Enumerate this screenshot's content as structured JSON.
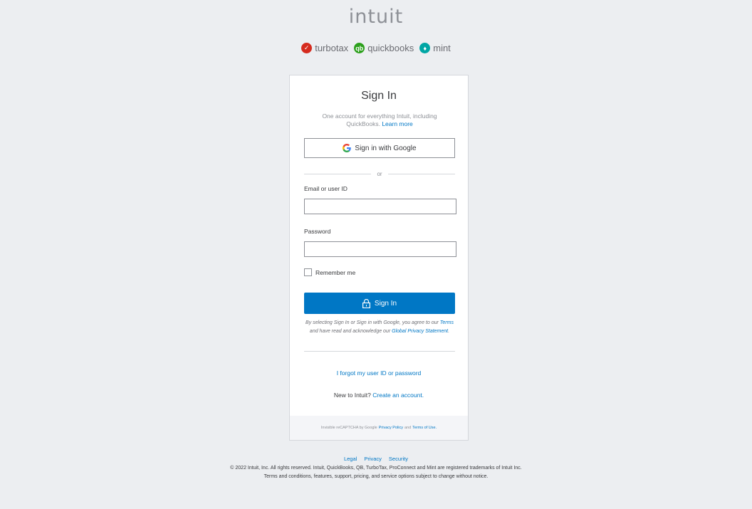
{
  "brand": {
    "logo_text": "INTUIT",
    "accent_color": "#0077c5"
  },
  "products": [
    {
      "name": "turbotax",
      "icon": "turbotax-check-icon",
      "color": "#d52b1e"
    },
    {
      "name": "quickbooks",
      "icon": "quickbooks-qb-icon",
      "color": "#2ca01c"
    },
    {
      "name": "mint",
      "icon": "mint-leaf-icon",
      "color": "#00a6a4"
    }
  ],
  "card": {
    "title": "Sign In",
    "subtitle": "One account for everything Intuit, including QuickBooks.",
    "learn_more": "Learn more",
    "google_button": "Sign in with Google",
    "divider_text": "or",
    "email_label": "Email or user ID",
    "email_value": "",
    "password_label": "Password",
    "password_value": "",
    "remember_label": "Remember me",
    "signin_button": "Sign In",
    "legal_prefix": "By selecting Sign In or Sign in with Google, you agree to our",
    "terms_link": "Terms",
    "legal_middle": "and have read and acknowledge our",
    "privacy_link": "Global Privacy Statement",
    "forgot_link": "I forgot my user ID or password",
    "new_prefix": "New to Intuit?",
    "create_link": "Create an account."
  },
  "recaptcha": {
    "prefix": "Invisible reCAPTCHA by Google",
    "privacy": "Privacy Policy",
    "and": "and",
    "terms": "Terms of Use."
  },
  "footer": {
    "links": [
      "Legal",
      "Privacy",
      "Security"
    ],
    "copyright_line1": "© 2022 Intuit, Inc. All rights reserved. Intuit, QuickBooks, QB, TurboTax, ProConnect and Mint are registered trademarks of Intuit Inc.",
    "copyright_line2": "Terms and conditions, features, support, pricing, and service options subject to change without notice."
  }
}
